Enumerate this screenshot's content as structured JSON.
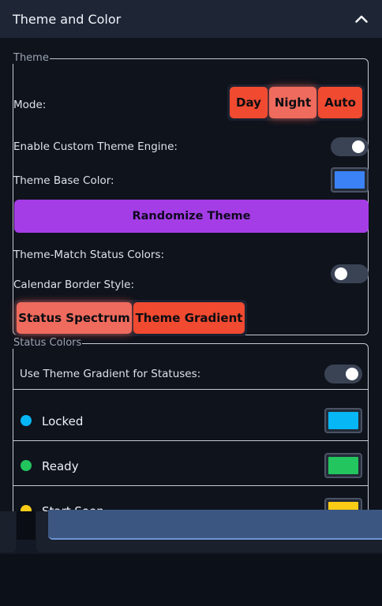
{
  "header": {
    "title": "Theme and Color",
    "collapse_icon": "chevron-up-icon"
  },
  "theme": {
    "legend": "Theme",
    "mode": {
      "label": "Mode:",
      "options": [
        "Day",
        "Night",
        "Auto"
      ],
      "selected": "Night"
    },
    "custom_engine": {
      "label": "Enable Custom Theme Engine:",
      "enabled": true
    },
    "base_color": {
      "label": "Theme Base Color:",
      "value": "#3b82f6"
    },
    "randomize_label": "Randomize Theme",
    "match_status": {
      "label": "Theme-Match Status Colors:",
      "enabled": false
    },
    "calendar_border": {
      "label": "Calendar Border Style:",
      "options": [
        "Status Spectrum",
        "Theme Gradient"
      ],
      "selected": "Status Spectrum"
    }
  },
  "status_colors": {
    "legend": "Status Colors",
    "use_gradient": {
      "label": "Use Theme Gradient for Statuses:",
      "enabled": true
    },
    "items": [
      {
        "name": "Locked",
        "color": "#06b6f5"
      },
      {
        "name": "Ready",
        "color": "#22c55e"
      },
      {
        "name": "Start Soon",
        "color": "#facc15"
      }
    ]
  },
  "colors": {
    "accent_red": "#f04a30",
    "accent_purple": "#a53de6",
    "header_bg": "#1e2636"
  }
}
